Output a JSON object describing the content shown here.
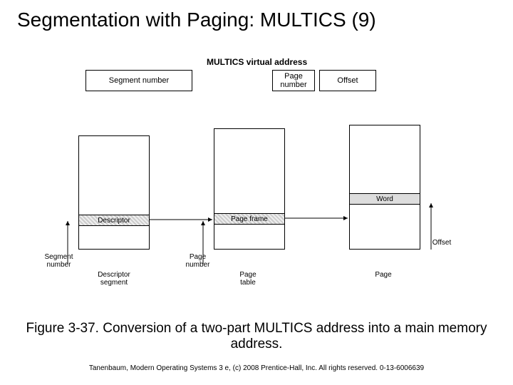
{
  "title": "Segmentation with Paging: MULTICS (9)",
  "diagram": {
    "va_label": "MULTICS virtual address",
    "fields": {
      "segment": "Segment number",
      "page": "Page\nnumber",
      "offset": "Offset"
    },
    "descriptor_table": {
      "entry": "Descriptor",
      "arrow_label": "Segment\nnumber",
      "caption": "Descriptor\nsegment"
    },
    "page_table": {
      "entry": "Page frame",
      "arrow_label": "Page\nnumber",
      "caption": "Page\ntable"
    },
    "page": {
      "entry": "Word",
      "arrow_label": "Offset",
      "caption": "Page"
    }
  },
  "caption": "Figure 3-37. Conversion of a two-part MULTICS address into a main memory address.",
  "footer": "Tanenbaum, Modern Operating Systems 3 e, (c) 2008 Prentice-Hall, Inc. All rights reserved. 0-13-6006639"
}
